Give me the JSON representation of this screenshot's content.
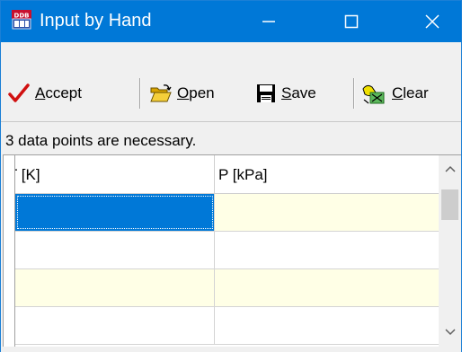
{
  "window": {
    "title": "Input by Hand",
    "app_icon_text": "DDB"
  },
  "toolbar": {
    "accept_label": "ccept",
    "accept_mnemonic": "A",
    "open_label": "pen",
    "open_mnemonic": "O",
    "save_label": "ave",
    "save_mnemonic": "S",
    "clear_label": "lear",
    "clear_mnemonic": "C"
  },
  "status": {
    "message": "3 data points are necessary."
  },
  "grid": {
    "columns": [
      "T [K]",
      "P [kPa]"
    ],
    "rows": [
      {
        "t": "",
        "p": ""
      },
      {
        "t": "",
        "p": ""
      },
      {
        "t": "",
        "p": ""
      },
      {
        "t": "",
        "p": ""
      }
    ]
  },
  "colors": {
    "titlebar": "#0078d7",
    "row_alt": "#ffffe6",
    "selection": "#0078d7"
  }
}
